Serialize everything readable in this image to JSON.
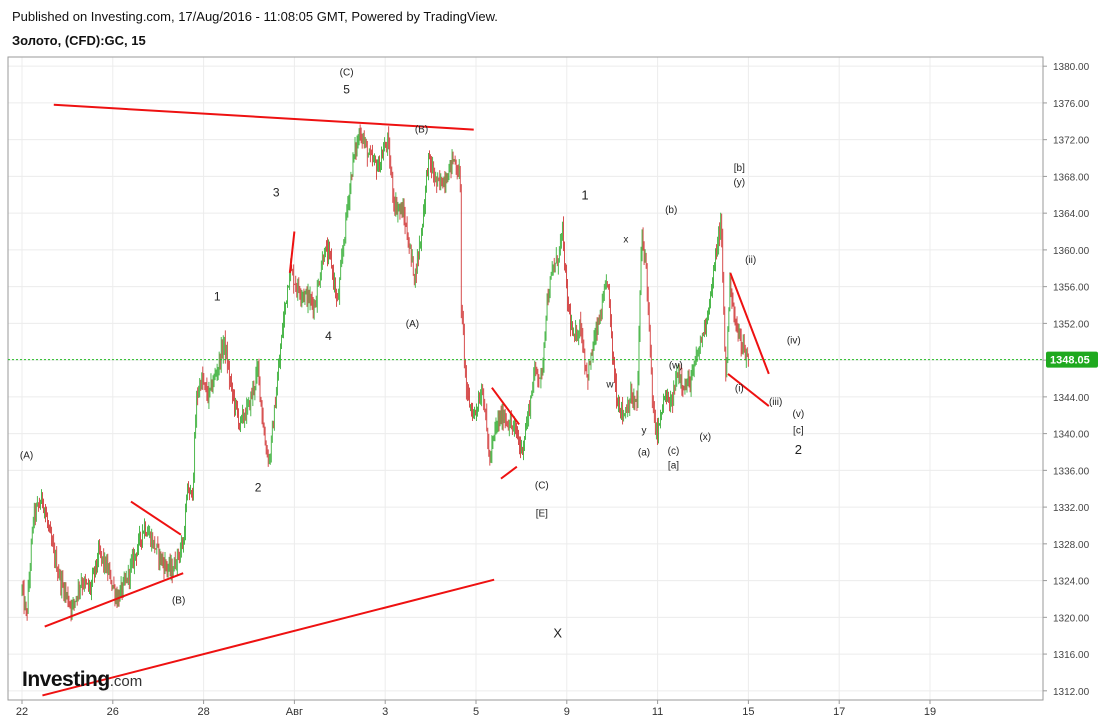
{
  "header": {
    "published": "Published on Investing.com, 17/Aug/2016 - 11:08:05 GMT, Powered by TradingView.",
    "symbol": "Золото, (CFD):GC, 15"
  },
  "logo": {
    "brand": "Investing",
    "suffix": ".com"
  },
  "colors": {
    "up": "#22a622",
    "down": "#cc2222",
    "trend": "#ee1111",
    "price_line": "#22bb22",
    "price_tag": "#1fa91f"
  },
  "chart_data": {
    "type": "candlestick",
    "instrument": "Золото, (CFD):GC, 15",
    "current_price": 1348.05,
    "current_price_label": "1348.05",
    "ylim": [
      1311,
      1381
    ],
    "y_ticks": [
      1312,
      1316,
      1320,
      1324,
      1328,
      1332,
      1336,
      1340,
      1344,
      1348,
      1352,
      1356,
      1360,
      1364,
      1368,
      1372,
      1376,
      1380
    ],
    "y_tick_labels": [
      "1312.00",
      "1316.00",
      "1320.00",
      "1324.00",
      "1328.00",
      "1332.00",
      "1336.00",
      "1340.00",
      "1344.00",
      "1348.00",
      "1352.00",
      "1356.00",
      "1360.00",
      "1364.00",
      "1368.00",
      "1372.00",
      "1376.00",
      "1380.00"
    ],
    "x_ticks": [
      "22",
      "26",
      "28",
      "Авг",
      "3",
      "5",
      "9",
      "11",
      "15",
      "17",
      "19"
    ],
    "price_path": [
      {
        "t": 0,
        "p": 1323
      },
      {
        "t": 0.2,
        "p": 1320
      },
      {
        "t": 0.5,
        "p": 1331
      },
      {
        "t": 0.9,
        "p": 1333
      },
      {
        "t": 1.3,
        "p": 1328
      },
      {
        "t": 1.7,
        "p": 1324
      },
      {
        "t": 2.2,
        "p": 1321
      },
      {
        "t": 2.6,
        "p": 1324
      },
      {
        "t": 3.0,
        "p": 1323
      },
      {
        "t": 3.4,
        "p": 1327
      },
      {
        "t": 3.8,
        "p": 1325
      },
      {
        "t": 4.2,
        "p": 1322
      },
      {
        "t": 4.6,
        "p": 1324
      },
      {
        "t": 5.0,
        "p": 1327
      },
      {
        "t": 5.4,
        "p": 1330
      },
      {
        "t": 5.8,
        "p": 1328
      },
      {
        "t": 6.2,
        "p": 1326
      },
      {
        "t": 6.6,
        "p": 1325
      },
      {
        "t": 6.9,
        "p": 1327
      },
      {
        "t": 7.1,
        "p": 1328
      },
      {
        "t": 7.3,
        "p": 1334
      },
      {
        "t": 7.5,
        "p": 1333
      },
      {
        "t": 7.7,
        "p": 1344
      },
      {
        "t": 7.9,
        "p": 1346
      },
      {
        "t": 8.2,
        "p": 1344
      },
      {
        "t": 8.6,
        "p": 1347
      },
      {
        "t": 8.9,
        "p": 1350
      },
      {
        "t": 9.2,
        "p": 1345
      },
      {
        "t": 9.6,
        "p": 1341
      },
      {
        "t": 10.0,
        "p": 1343
      },
      {
        "t": 10.4,
        "p": 1347
      },
      {
        "t": 10.7,
        "p": 1339
      },
      {
        "t": 10.9,
        "p": 1337
      },
      {
        "t": 11.1,
        "p": 1342
      },
      {
        "t": 11.5,
        "p": 1352
      },
      {
        "t": 11.8,
        "p": 1358
      },
      {
        "t": 12.1,
        "p": 1356
      },
      {
        "t": 12.5,
        "p": 1355
      },
      {
        "t": 12.9,
        "p": 1354
      },
      {
        "t": 13.3,
        "p": 1360
      },
      {
        "t": 13.6,
        "p": 1359
      },
      {
        "t": 13.9,
        "p": 1354
      },
      {
        "t": 14.3,
        "p": 1364
      },
      {
        "t": 14.6,
        "p": 1370
      },
      {
        "t": 14.9,
        "p": 1373
      },
      {
        "t": 15.3,
        "p": 1370
      },
      {
        "t": 15.7,
        "p": 1369
      },
      {
        "t": 16.1,
        "p": 1372
      },
      {
        "t": 16.4,
        "p": 1365
      },
      {
        "t": 16.8,
        "p": 1364
      },
      {
        "t": 17.3,
        "p": 1357
      },
      {
        "t": 17.6,
        "p": 1362
      },
      {
        "t": 17.9,
        "p": 1370
      },
      {
        "t": 18.3,
        "p": 1367
      },
      {
        "t": 18.7,
        "p": 1368
      },
      {
        "t": 19.0,
        "p": 1370
      },
      {
        "t": 19.3,
        "p": 1368
      },
      {
        "t": 19.35,
        "p": 1354
      },
      {
        "t": 19.6,
        "p": 1344
      },
      {
        "t": 19.9,
        "p": 1342
      },
      {
        "t": 20.3,
        "p": 1345
      },
      {
        "t": 20.6,
        "p": 1337
      },
      {
        "t": 20.9,
        "p": 1341
      },
      {
        "t": 21.2,
        "p": 1342
      },
      {
        "t": 21.5,
        "p": 1341
      },
      {
        "t": 21.8,
        "p": 1340
      },
      {
        "t": 22.0,
        "p": 1338
      },
      {
        "t": 22.3,
        "p": 1342
      },
      {
        "t": 22.6,
        "p": 1347
      },
      {
        "t": 22.9,
        "p": 1346
      },
      {
        "t": 23.1,
        "p": 1354
      },
      {
        "t": 23.4,
        "p": 1358
      },
      {
        "t": 23.6,
        "p": 1359
      },
      {
        "t": 23.8,
        "p": 1362
      },
      {
        "t": 24.0,
        "p": 1355
      },
      {
        "t": 24.3,
        "p": 1350
      },
      {
        "t": 24.6,
        "p": 1352
      },
      {
        "t": 24.9,
        "p": 1346
      },
      {
        "t": 25.2,
        "p": 1350
      },
      {
        "t": 25.5,
        "p": 1353
      },
      {
        "t": 25.8,
        "p": 1357
      },
      {
        "t": 26.0,
        "p": 1349
      },
      {
        "t": 26.2,
        "p": 1344
      },
      {
        "t": 26.5,
        "p": 1342
      },
      {
        "t": 26.8,
        "p": 1344
      },
      {
        "t": 27.1,
        "p": 1343
      },
      {
        "t": 27.3,
        "p": 1362
      },
      {
        "t": 27.5,
        "p": 1358
      },
      {
        "t": 27.8,
        "p": 1342
      },
      {
        "t": 28.0,
        "p": 1340
      },
      {
        "t": 28.3,
        "p": 1344
      },
      {
        "t": 28.6,
        "p": 1343
      },
      {
        "t": 28.9,
        "p": 1347
      },
      {
        "t": 29.2,
        "p": 1345
      },
      {
        "t": 29.5,
        "p": 1346
      },
      {
        "t": 29.8,
        "p": 1349
      },
      {
        "t": 30.1,
        "p": 1352
      },
      {
        "t": 30.4,
        "p": 1356
      },
      {
        "t": 30.6,
        "p": 1360
      },
      {
        "t": 30.8,
        "p": 1363
      },
      {
        "t": 31.0,
        "p": 1346
      },
      {
        "t": 31.2,
        "p": 1357
      },
      {
        "t": 31.4,
        "p": 1352
      },
      {
        "t": 31.7,
        "p": 1350
      },
      {
        "t": 32.0,
        "p": 1348
      }
    ],
    "trendlines": [
      {
        "t1": 1.4,
        "p1": 1375.8,
        "t2": 19.9,
        "p2": 1373.1
      },
      {
        "t1": 0.9,
        "p1": 1311.5,
        "t2": 20.8,
        "p2": 1324.1
      },
      {
        "t1": 1.0,
        "p1": 1319.0,
        "t2": 7.1,
        "p2": 1324.8
      },
      {
        "t1": 4.8,
        "p1": 1332.6,
        "t2": 7.0,
        "p2": 1329.0
      },
      {
        "t1": 11.8,
        "p1": 1357.5,
        "t2": 12.0,
        "p2": 1362.0
      },
      {
        "t1": 20.7,
        "p1": 1345.0,
        "t2": 21.9,
        "p2": 1341.0
      },
      {
        "t1": 21.1,
        "p1": 1335.1,
        "t2": 21.8,
        "p2": 1336.4
      },
      {
        "t1": 31.2,
        "p1": 1357.5,
        "t2": 32.9,
        "p2": 1346.5
      },
      {
        "t1": 31.1,
        "p1": 1346.5,
        "t2": 32.9,
        "p2": 1343.0
      }
    ],
    "wave_labels": [
      {
        "text": "(A)",
        "t": 0.2,
        "p": 1337.3,
        "size": 10
      },
      {
        "text": "(B)",
        "t": 6.9,
        "p": 1321.5,
        "size": 10
      },
      {
        "text": "1",
        "t": 8.6,
        "p": 1354.5,
        "size": 12
      },
      {
        "text": "2",
        "t": 10.4,
        "p": 1333.7,
        "size": 12
      },
      {
        "text": "3",
        "t": 11.2,
        "p": 1365.8,
        "size": 12
      },
      {
        "text": "4",
        "t": 13.5,
        "p": 1350.2,
        "size": 12
      },
      {
        "text": "(C)",
        "t": 14.3,
        "p": 1379.0,
        "size": 10
      },
      {
        "text": "5",
        "t": 14.3,
        "p": 1377.0,
        "size": 12
      },
      {
        "text": "(B)",
        "t": 17.6,
        "p": 1372.8,
        "size": 10
      },
      {
        "text": "(A)",
        "t": 17.2,
        "p": 1351.6,
        "size": 10
      },
      {
        "text": "(C)",
        "t": 22.9,
        "p": 1334.0,
        "size": 10
      },
      {
        "text": "[E]",
        "t": 22.9,
        "p": 1331.0,
        "size": 10
      },
      {
        "text": "X",
        "t": 23.6,
        "p": 1317.8,
        "size": 13
      },
      {
        "text": "1",
        "t": 24.8,
        "p": 1365.5,
        "size": 13
      },
      {
        "text": "x",
        "t": 26.6,
        "p": 1360.8,
        "size": 10
      },
      {
        "text": "w",
        "t": 25.9,
        "p": 1345.0,
        "size": 10
      },
      {
        "text": "y",
        "t": 27.4,
        "p": 1340.0,
        "size": 10
      },
      {
        "text": "(a)",
        "t": 27.4,
        "p": 1337.6,
        "size": 10
      },
      {
        "text": "(b)",
        "t": 28.6,
        "p": 1364.0,
        "size": 10
      },
      {
        "text": "(c)",
        "t": 28.7,
        "p": 1337.8,
        "size": 10
      },
      {
        "text": "[a]",
        "t": 28.7,
        "p": 1336.2,
        "size": 10
      },
      {
        "text": "(w)",
        "t": 28.8,
        "p": 1347.1,
        "size": 10
      },
      {
        "text": "(x)",
        "t": 30.1,
        "p": 1339.3,
        "size": 10
      },
      {
        "text": "[b]",
        "t": 31.6,
        "p": 1368.6,
        "size": 10
      },
      {
        "text": "(y)",
        "t": 31.6,
        "p": 1367.0,
        "size": 10
      },
      {
        "text": "(ii)",
        "t": 32.1,
        "p": 1358.6,
        "size": 10
      },
      {
        "text": "(i)",
        "t": 31.6,
        "p": 1344.6,
        "size": 10
      },
      {
        "text": "(iii)",
        "t": 33.2,
        "p": 1343.1,
        "size": 10
      },
      {
        "text": "(iv)",
        "t": 34.0,
        "p": 1349.8,
        "size": 10
      },
      {
        "text": "(v)",
        "t": 34.2,
        "p": 1341.8,
        "size": 10
      },
      {
        "text": "[c]",
        "t": 34.2,
        "p": 1340.0,
        "size": 10
      },
      {
        "text": "2",
        "t": 34.2,
        "p": 1337.8,
        "size": 13
      }
    ]
  }
}
